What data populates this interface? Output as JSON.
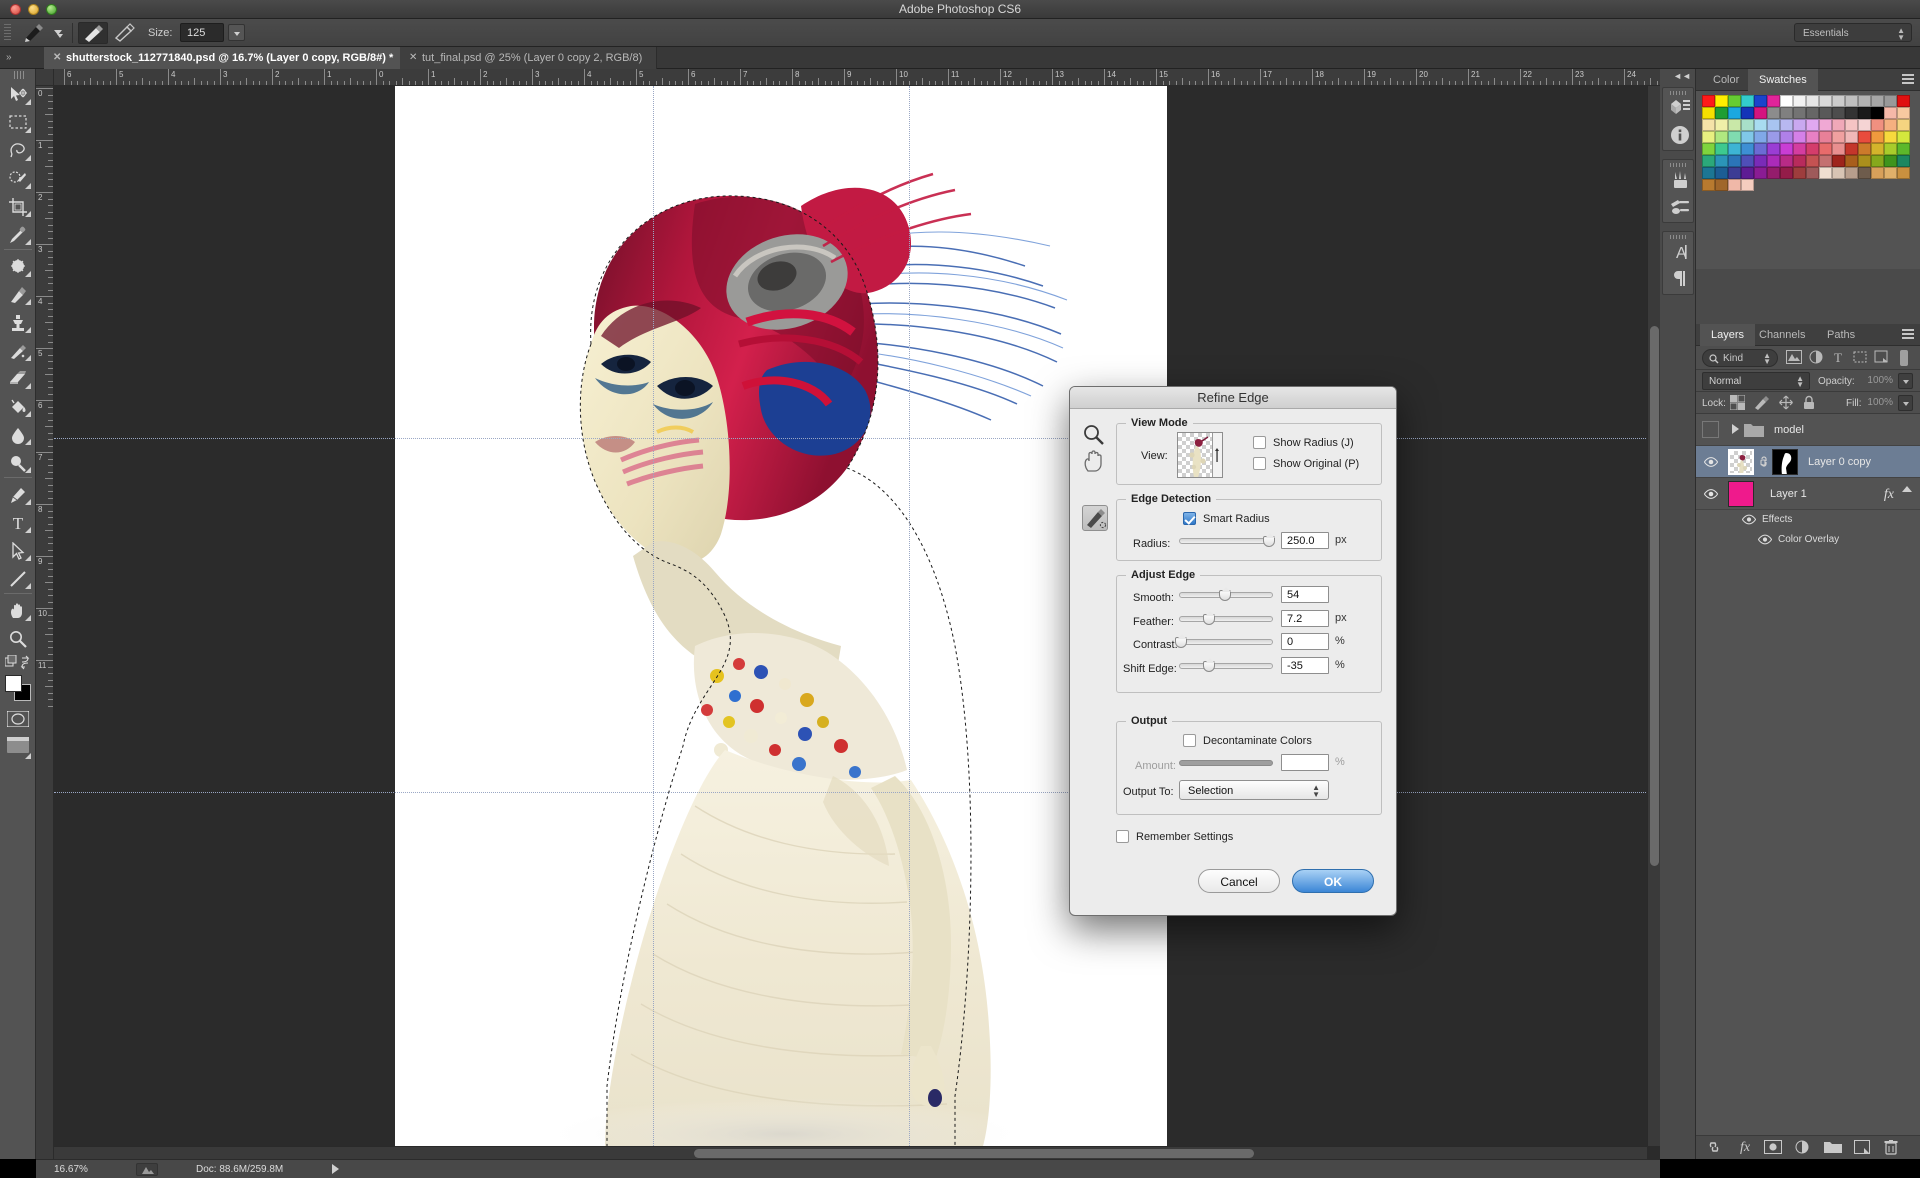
{
  "app": {
    "title": "Adobe Photoshop CS6"
  },
  "window_controls": {
    "close": "close-button",
    "minimize": "minimize-button",
    "zoom": "zoom-button"
  },
  "options_bar": {
    "size_label": "Size:",
    "size_value": "125",
    "workspace": "Essentials"
  },
  "tabs": [
    {
      "label": "shutterstock_112771840.psd @ 16.7% (Layer 0 copy, RGB/8#) *",
      "active": true
    },
    {
      "label": "tut_final.psd @ 25% (Layer 0 copy 2, RGB/8)",
      "active": false
    }
  ],
  "tools": [
    {
      "name": "move-tool"
    },
    {
      "name": "rectangular-marquee-tool"
    },
    {
      "name": "lasso-tool"
    },
    {
      "name": "quick-selection-tool"
    },
    {
      "name": "crop-tool"
    },
    {
      "name": "eyedropper-tool"
    },
    {
      "name": "spot-healing-brush-tool"
    },
    {
      "name": "brush-tool"
    },
    {
      "name": "clone-stamp-tool"
    },
    {
      "name": "history-brush-tool"
    },
    {
      "name": "eraser-tool"
    },
    {
      "name": "gradient-tool"
    },
    {
      "name": "blur-tool"
    },
    {
      "name": "dodge-tool"
    },
    {
      "name": "pen-tool"
    },
    {
      "name": "horizontal-type-tool"
    },
    {
      "name": "path-selection-tool"
    },
    {
      "name": "line-tool"
    },
    {
      "name": "hand-tool"
    },
    {
      "name": "zoom-tool"
    }
  ],
  "rulers": {
    "horizontal_ticks": [
      "6",
      "5",
      "4",
      "3",
      "2",
      "1",
      "0",
      "1",
      "2",
      "3",
      "4",
      "5",
      "6",
      "7",
      "8",
      "9",
      "10",
      "11",
      "12",
      "13",
      "14",
      "15",
      "16",
      "17",
      "18",
      "19",
      "20",
      "21",
      "22",
      "23",
      "24"
    ],
    "vertical_ticks": [
      "0",
      "1",
      "2",
      "3",
      "4",
      "5",
      "6",
      "7",
      "8",
      "9",
      "10",
      "11"
    ],
    "units": "inches"
  },
  "status_bar": {
    "zoom": "16.67%",
    "doc": "Doc: 88.6M/259.8M"
  },
  "rail_icons": [
    {
      "name": "mini-bridge-icon"
    },
    {
      "name": "info-icon"
    },
    {
      "name": "brush-presets-icon"
    },
    {
      "name": "brush-panel-icon"
    },
    {
      "name": "character-panel-icon"
    },
    {
      "name": "paragraph-panel-icon"
    }
  ],
  "color_panel": {
    "tabs": [
      {
        "label": "Color",
        "active": false
      },
      {
        "label": "Swatches",
        "active": true
      }
    ],
    "swatch_colors": [
      "#ff1a1a",
      "#ffef00",
      "#66cc33",
      "#33cccc",
      "#1a44cc",
      "#e0249a",
      "#ffffff",
      "#f2f2f2",
      "#e6e6e6",
      "#d9d9d9",
      "#cccccc",
      "#bfbfbf",
      "#b3b3b3",
      "#a6a6a6",
      "#999999",
      "#e01010",
      "#f5e000",
      "#1f9e33",
      "#1aa8e0",
      "#1433b8",
      "#d4147f",
      "#8c8c8c",
      "#808080",
      "#737373",
      "#666666",
      "#595959",
      "#4d4d4d",
      "#333333",
      "#1a1a1a",
      "#000000",
      "#f5b8a8",
      "#f7c9a0",
      "#f5e3a8",
      "#f0f0a8",
      "#c9e8a8",
      "#a8e0c9",
      "#a8dcf0",
      "#a8c4f0",
      "#b8b8f0",
      "#c9a8f0",
      "#e0a8f0",
      "#f0a8d4",
      "#f0a8b8",
      "#f5c4c4",
      "#f5d4d4",
      "#f09080",
      "#f5b080",
      "#f5d480",
      "#e8f080",
      "#b0e880",
      "#80dcb0",
      "#80c8e8",
      "#80a8e8",
      "#9a9ae8",
      "#b080e8",
      "#d480e8",
      "#e880c4",
      "#e88098",
      "#f0a0a0",
      "#f0b8b8",
      "#e84c3d",
      "#f09a3d",
      "#f7d93d",
      "#d4e83d",
      "#7fd43d",
      "#3dc98f",
      "#3db4d4",
      "#3d8fd4",
      "#6b6bd4",
      "#9a3dd4",
      "#c93dd4",
      "#d43da0",
      "#d43d6b",
      "#e86b6b",
      "#e88f8f",
      "#c4362b",
      "#cc7a2b",
      "#d4b42b",
      "#a8cc2b",
      "#5cb82b",
      "#2ba87a",
      "#2b94b8",
      "#2b74b8",
      "#4f4fb8",
      "#7a2bb8",
      "#ab2bb8",
      "#b82b86",
      "#b82b5c",
      "#c45252",
      "#c47070",
      "#9e241c",
      "#a85e1c",
      "#ab8f1c",
      "#86a81c",
      "#3f941c",
      "#1c8760",
      "#1c7694",
      "#1c5d94",
      "#3c3c94",
      "#5e1c94",
      "#8a1c94",
      "#941c6c",
      "#941c49",
      "#9e3d3d",
      "#9e5a5a",
      "#f0ded0",
      "#d8c4b4",
      "#b89e8c",
      "#6e5c4c",
      "#d8a05a",
      "#e0b06a",
      "#c9903f",
      "#b87a2f",
      "#a0662a",
      "#f0b8a8",
      "#f5cdbf"
    ]
  },
  "layers_panel": {
    "tabs": [
      {
        "label": "Layers",
        "active": true
      },
      {
        "label": "Channels",
        "active": false
      },
      {
        "label": "Paths",
        "active": false
      }
    ],
    "kind_filter": "Kind",
    "blend_mode": "Normal",
    "opacity_label": "Opacity:",
    "opacity_value": "100%",
    "lock_label": "Lock:",
    "fill_label": "Fill:",
    "fill_value": "100%",
    "rows": [
      {
        "name": "model",
        "type": "group",
        "visible": false,
        "selected": false,
        "expanded": false
      },
      {
        "name": "Layer 0 copy",
        "type": "layer",
        "visible": true,
        "selected": true,
        "has_mask": true,
        "linked": true
      },
      {
        "name": "Layer 1",
        "type": "layer",
        "visible": true,
        "selected": false,
        "has_fx": true,
        "color": "#ef1a8c"
      }
    ],
    "effects": {
      "label": "Effects",
      "items": [
        "Color Overlay"
      ]
    },
    "bottom_icons": [
      {
        "name": "link-layers-icon"
      },
      {
        "name": "layer-style-fx-icon"
      },
      {
        "name": "add-layer-mask-icon"
      },
      {
        "name": "new-adjustment-layer-icon"
      },
      {
        "name": "new-group-icon"
      },
      {
        "name": "new-layer-icon"
      },
      {
        "name": "delete-layer-icon"
      }
    ]
  },
  "refine_edge": {
    "title": "Refine Edge",
    "tools": [
      {
        "name": "zoom-tool-icon"
      },
      {
        "name": "hand-tool-icon"
      },
      {
        "name": "refine-radius-brush-icon"
      }
    ],
    "view_mode": {
      "legend": "View Mode",
      "view_label": "View:",
      "show_radius_label": "Show Radius (J)",
      "show_radius_checked": false,
      "show_original_label": "Show Original (P)",
      "show_original_checked": false
    },
    "edge_detection": {
      "legend": "Edge Detection",
      "smart_radius_label": "Smart Radius",
      "smart_radius_checked": true,
      "radius_label": "Radius:",
      "radius_value": "250.0",
      "radius_unit": "px",
      "radius_pct": 96
    },
    "adjust_edge": {
      "legend": "Adjust Edge",
      "rows": [
        {
          "label": "Smooth:",
          "value": "54",
          "unit": "",
          "pct": 46
        },
        {
          "label": "Feather:",
          "value": "7.2",
          "unit": "px",
          "pct": 26
        },
        {
          "label": "Contrast:",
          "value": "0",
          "unit": "%",
          "pct": 0
        },
        {
          "label": "Shift Edge:",
          "value": "-35",
          "unit": "%",
          "pct": 26
        }
      ]
    },
    "output": {
      "legend": "Output",
      "decontaminate_label": "Decontaminate Colors",
      "decontaminate_checked": false,
      "amount_label": "Amount:",
      "amount_value": "",
      "amount_unit": "%",
      "output_to_label": "Output To:",
      "output_to_value": "Selection"
    },
    "remember_settings_label": "Remember Settings",
    "remember_settings_checked": false,
    "cancel_label": "Cancel",
    "ok_label": "OK"
  },
  "colors": {
    "accent_blue": "#3c86d6",
    "panel_bg": "#535353",
    "dialog_bg": "#ececec",
    "selected_layer": "#6c7d94",
    "magenta_layer": "#ef1a8c"
  }
}
